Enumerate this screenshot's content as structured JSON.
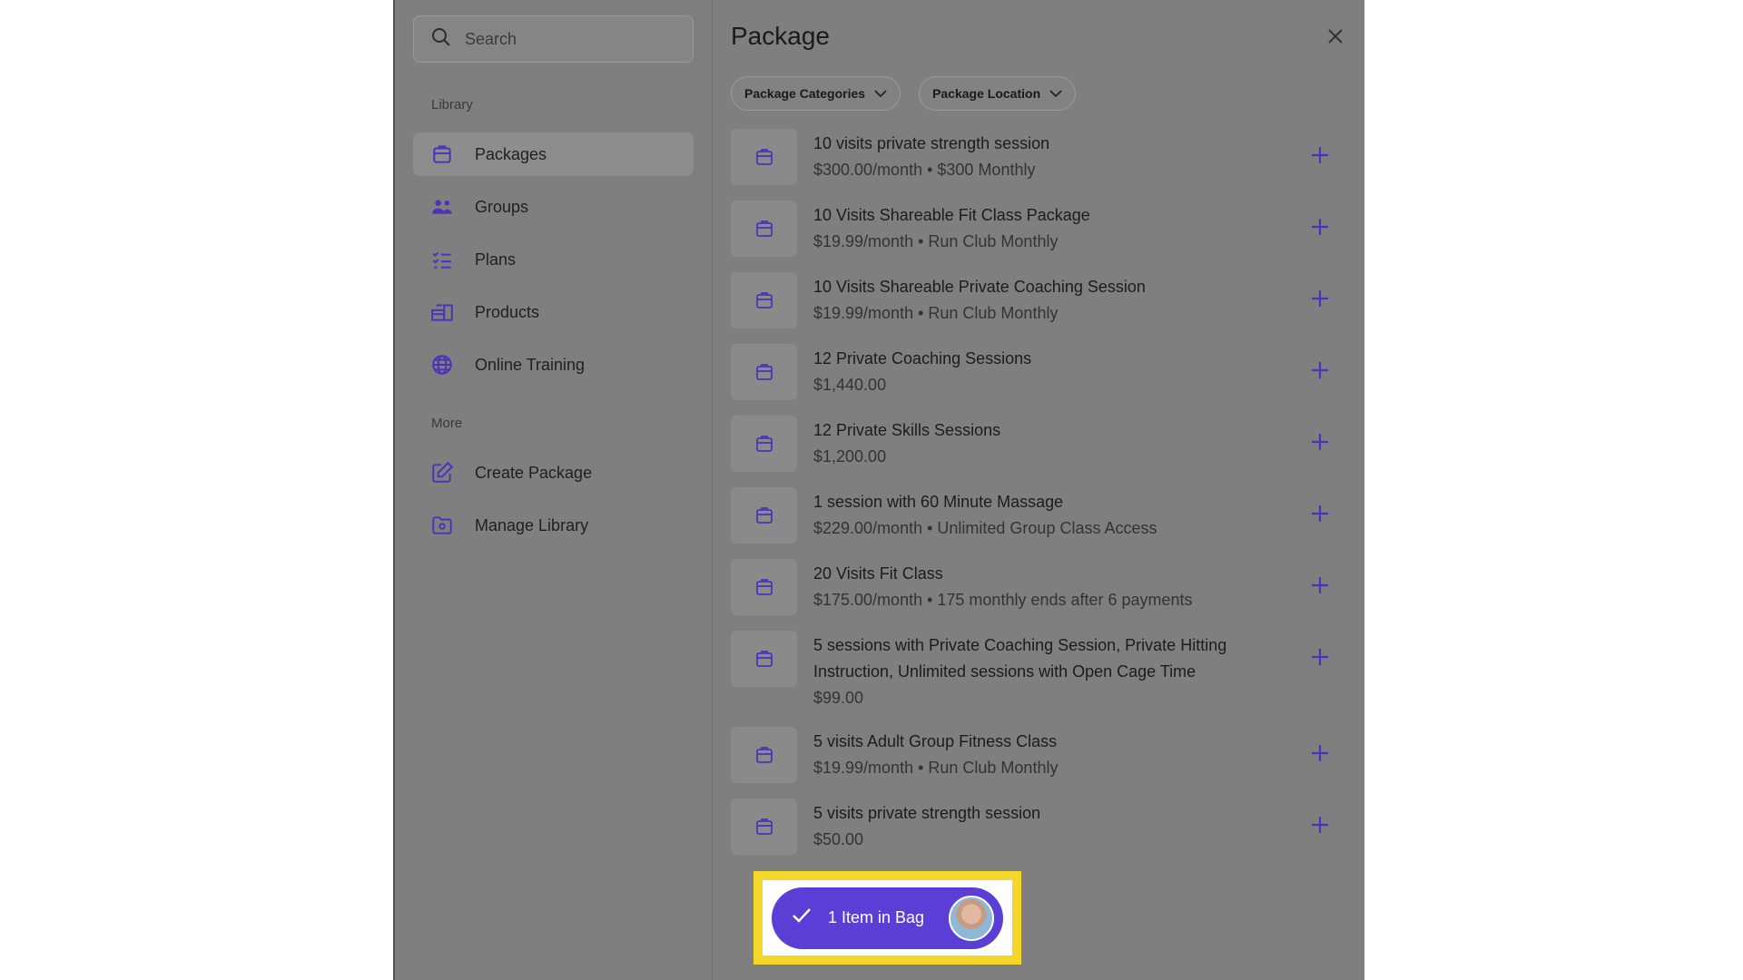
{
  "search": {
    "placeholder": "Search"
  },
  "sidebar": {
    "library_label": "Library",
    "items": [
      {
        "label": "Packages",
        "icon": "package-icon",
        "active": true
      },
      {
        "label": "Groups",
        "icon": "groups-icon",
        "active": false
      },
      {
        "label": "Plans",
        "icon": "plans-icon",
        "active": false
      },
      {
        "label": "Products",
        "icon": "products-icon",
        "active": false
      },
      {
        "label": "Online Training",
        "icon": "globe-icon",
        "active": false
      }
    ],
    "more_label": "More",
    "more_items": [
      {
        "label": "Create Package",
        "icon": "edit-icon"
      },
      {
        "label": "Manage Library",
        "icon": "folder-icon"
      }
    ]
  },
  "main": {
    "title": "Package",
    "filters": [
      {
        "label": "Package Categories"
      },
      {
        "label": "Package Location"
      }
    ],
    "packages": [
      {
        "name": "10 visits private strength session",
        "sub": "$300.00/month • $300 Monthly"
      },
      {
        "name": "10 Visits Shareable Fit Class Package",
        "sub": "$19.99/month • Run Club Monthly"
      },
      {
        "name": "10 Visits Shareable Private Coaching Session",
        "sub": "$19.99/month • Run Club Monthly"
      },
      {
        "name": "12 Private Coaching Sessions",
        "sub": "$1,440.00"
      },
      {
        "name": "12 Private Skills Sessions",
        "sub": "$1,200.00"
      },
      {
        "name": "1 session with 60 Minute Massage",
        "sub": "$229.00/month • Unlimited Group Class Access"
      },
      {
        "name": "20 Visits Fit Class",
        "sub": "$175.00/month • 175 monthly ends after 6 payments"
      },
      {
        "name": "5 sessions with Private Coaching Session, Private Hitting Instruction, Unlimited sessions with Open Cage Time",
        "sub": "$99.00"
      },
      {
        "name": "5 visits Adult Group Fitness Class",
        "sub": "$19.99/month • Run Club Monthly"
      },
      {
        "name": "5 visits private strength session",
        "sub": "$50.00"
      }
    ]
  },
  "bag": {
    "label": "1 Item in Bag"
  },
  "colors": {
    "accent": "#5b3ed6",
    "highlight": "#f5d62b",
    "overlay": "#7f7f7f"
  }
}
